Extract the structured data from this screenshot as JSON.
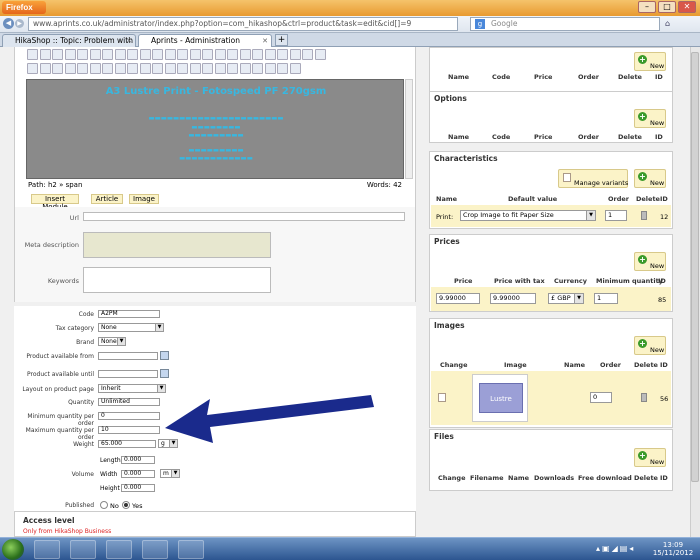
{
  "browser": {
    "menu_button": "Firefox",
    "url": "www.aprints.co.uk/administrator/index.php?option=com_hikashop&ctrl=product&task=edit&cid[]=9",
    "search_placeholder": "Google",
    "tabs": [
      {
        "label": "HikaShop :: Topic: Problem with limit..."
      },
      {
        "label": "Aprints - Administration"
      }
    ],
    "new_tab": "+"
  },
  "editor": {
    "heading": "A3 Lustre Print - Fotospeed PF 270gsm",
    "path_label": "Path: h2 » span",
    "words_label": "Words: 42",
    "buttons": [
      "Insert Module",
      "Article",
      "Image"
    ]
  },
  "meta": {
    "url_label": "Url",
    "meta_desc_label": "Meta description",
    "keywords_label": "Keywords"
  },
  "form": {
    "code_label": "Code",
    "code_value": "A2PM",
    "tax_label": "Tax category",
    "tax_value": "None",
    "brand_label": "Brand",
    "brand_value": "None",
    "avail_from_label": "Product available from",
    "avail_until_label": "Product available until",
    "layout_label": "Layout on product page",
    "layout_value": "Inherit",
    "quantity_label": "Quantity",
    "quantity_value": "Unlimited",
    "min_qty_label": "Minimum quantity per order",
    "min_qty_value": "0",
    "max_qty_label": "Maximum quantity per order",
    "max_qty_value": "10",
    "weight_label": "Weight",
    "weight_value": "65.000",
    "weight_unit": "g",
    "volume_label": "Volume",
    "length_label": "Length",
    "length_value": "0.000",
    "width_label": "Width",
    "width_value": "0.000",
    "width_unit": "m",
    "height_label": "Height",
    "height_value": "0.000",
    "published_label": "Published",
    "published_no": "No",
    "published_yes": "Yes",
    "access_title": "Access level",
    "access_note": "Only from HikaShop Business"
  },
  "panels": {
    "related": {
      "new_label": "New",
      "headers": [
        "Name",
        "Code",
        "Price",
        "Order",
        "Delete",
        "ID"
      ]
    },
    "options": {
      "title": "Options",
      "new_label": "New",
      "headers": [
        "Name",
        "Code",
        "Price",
        "Order",
        "Delete",
        "ID"
      ]
    },
    "characteristics": {
      "title": "Characteristics",
      "manage_label": "Manage variants",
      "new_label": "New",
      "headers": [
        "Name",
        "Default value",
        "Order",
        "Delete",
        "ID"
      ],
      "row": {
        "name": "Print:",
        "default": "Crop Image to fit Paper Size",
        "order": "1",
        "id": "12"
      }
    },
    "prices": {
      "title": "Prices",
      "new_label": "New",
      "headers": [
        "Price",
        "Price with tax",
        "Currency",
        "Minimum quantity",
        "ID"
      ],
      "row": {
        "price": "9.99000",
        "price_tax": "9.99000",
        "currency": "£ GBP",
        "min_qty": "1",
        "id": "85"
      }
    },
    "images": {
      "title": "Images",
      "new_label": "New",
      "headers": [
        "Change",
        "Image",
        "Name",
        "Order",
        "Delete",
        "ID"
      ],
      "row": {
        "thumb_text": "Lustre",
        "order": "0",
        "id": "56"
      }
    },
    "files": {
      "title": "Files",
      "new_label": "New",
      "headers": [
        "Change",
        "Filename",
        "Name",
        "Downloads",
        "Free download",
        "Delete",
        "ID"
      ]
    }
  },
  "taskbar": {
    "time": "13:09",
    "date": "15/11/2012"
  },
  "colors": {
    "arrow": "#1a2a8c",
    "accent": "#38b7e0",
    "highlight": "#fbf3c8"
  }
}
